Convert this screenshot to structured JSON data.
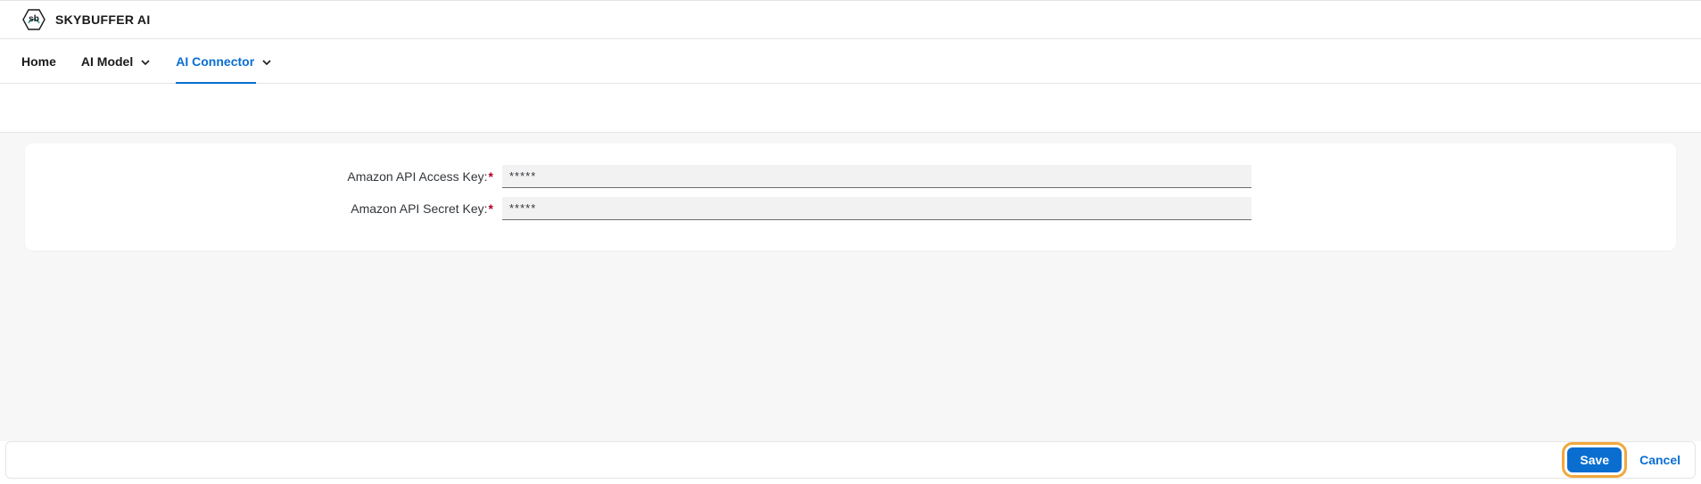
{
  "header": {
    "app_title": "SKYBUFFER AI"
  },
  "nav": {
    "home": "Home",
    "ai_model": "AI Model",
    "ai_connector": "AI Connector"
  },
  "form": {
    "access_key_label": "Amazon API Access Key:",
    "access_key_value": "*****",
    "secret_key_label": "Amazon API Secret Key:",
    "secret_key_value": "*****",
    "required_mark": "*"
  },
  "footer": {
    "save_label": "Save",
    "cancel_label": "Cancel"
  }
}
